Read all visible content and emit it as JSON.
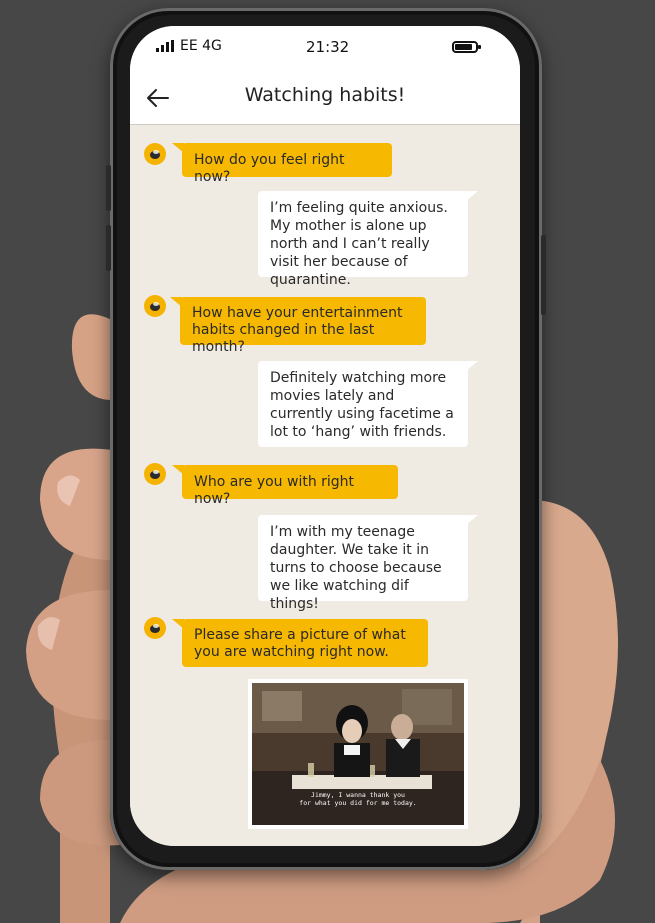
{
  "status_bar": {
    "carrier": "EE 4G",
    "time": "21:32",
    "battery_level": 0.85,
    "icons": [
      "signal-icon",
      "battery-icon"
    ]
  },
  "header": {
    "title": "Watching habits!",
    "back_icon": "arrow-left-icon"
  },
  "messages": [
    {
      "from": "bot",
      "text": "How do you feel right now?"
    },
    {
      "from": "user",
      "text": "I’m feeling quite anxious. My mother is alone up north and I can’t really visit her because of quarantine."
    },
    {
      "from": "bot",
      "text": "How have your entertainment habits changed in the last month?"
    },
    {
      "from": "user",
      "text": "Definitely watching more movies lately and currently using facetime a lot to ‘hang’ with friends."
    },
    {
      "from": "bot",
      "text": "Who are you with right now?"
    },
    {
      "from": "user",
      "text": "I’m with my teenage daughter. We take it in turns to choose because we like watching dif things!"
    },
    {
      "from": "bot",
      "text": "Please share a picture of what you are watching right now."
    }
  ],
  "photo": {
    "subtitle_line1": "Jimmy, I wanna thank you",
    "subtitle_line2": "for what you did for me today."
  },
  "colors": {
    "accent": "#f6b800",
    "chat_background": "#efebe3",
    "user_bubble": "#ffffff"
  }
}
